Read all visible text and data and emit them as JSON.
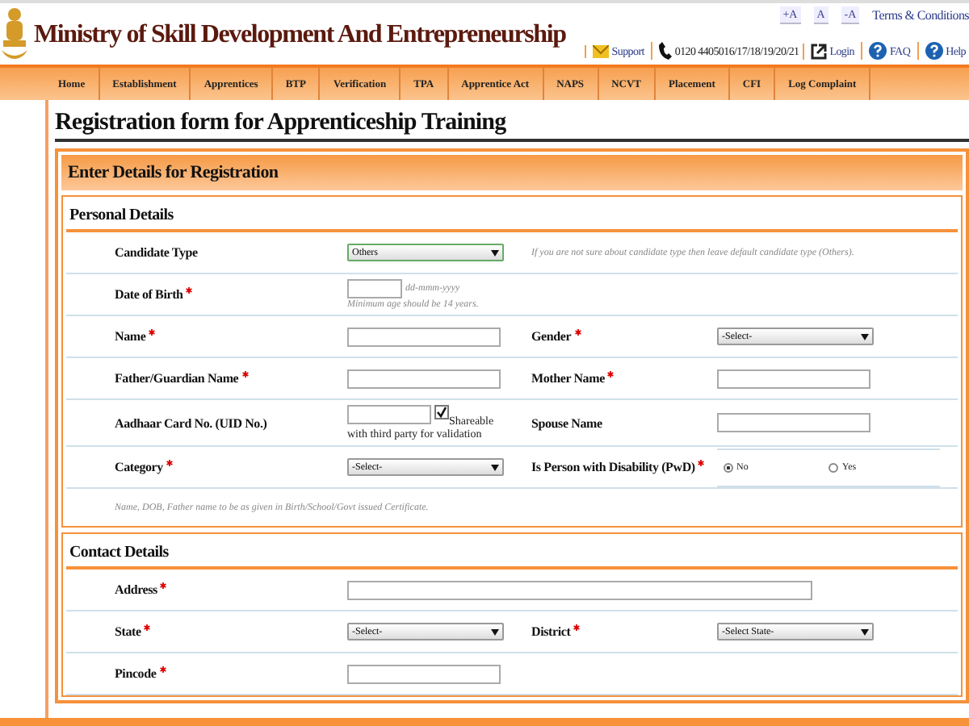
{
  "header": {
    "title": "Ministry of Skill Development And Entrepreneurship",
    "font_buttons": [
      "+A",
      "A",
      "-A"
    ],
    "terms_link": "Terms & Conditions",
    "utility_links": [
      {
        "kind": "support",
        "label": "Support"
      },
      {
        "kind": "phone",
        "label": "0120 4405016/17/18/19/20/21"
      },
      {
        "kind": "login",
        "label": "Login"
      },
      {
        "kind": "faq",
        "label": "FAQ"
      },
      {
        "kind": "help",
        "label": "Help"
      }
    ]
  },
  "nav": {
    "items": [
      "Home",
      "Establishment",
      "Apprentices",
      "BTP",
      "Verification",
      "TPA",
      "Apprentice Act",
      "NAPS",
      "NCVT",
      "Placement",
      "CFI",
      "Log Complaint"
    ]
  },
  "page_title": "Registration form for Apprenticeship Training",
  "form": {
    "header": "Enter Details for Registration",
    "sections": [
      {
        "title": "Personal Details",
        "rows": [
          {
            "fields": [
              {
                "label": "Candidate Type",
                "required": false,
                "kind": "select",
                "value": "Others",
                "hint": "If you are not sure about candidate type then leave default candidate type (Others)."
              }
            ]
          },
          {
            "fields": [
              {
                "label": "Date of Birth",
                "required": true,
                "kind": "date",
                "format_hint": "dd-mmm-yyyy",
                "hint": "Minimum age should be 14 years."
              }
            ]
          },
          {
            "fields": [
              {
                "label": "Name",
                "required": true,
                "kind": "text"
              },
              {
                "label": "Gender",
                "required": true,
                "kind": "select",
                "value": "-Select-"
              }
            ]
          },
          {
            "fields": [
              {
                "label": "Father/Guardian Name",
                "required": true,
                "kind": "text"
              },
              {
                "label": "Mother Name",
                "required": true,
                "kind": "text"
              }
            ]
          },
          {
            "fields": [
              {
                "label": "Aadhaar Card No. (UID No.)",
                "required": false,
                "kind": "aadhaar",
                "checkbox": {
                  "label": "Shareable with third party for validation",
                  "checked": true
                }
              },
              {
                "label": "Spouse Name",
                "required": false,
                "kind": "text"
              }
            ]
          },
          {
            "fields": [
              {
                "label": "Category",
                "required": true,
                "kind": "select",
                "value": "-Select-"
              },
              {
                "label": "Is Person with Disability (PwD)",
                "required": true,
                "kind": "radio",
                "options": [
                  {
                    "label": "No",
                    "selected": true
                  },
                  {
                    "label": "Yes",
                    "selected": false
                  }
                ]
              }
            ]
          }
        ],
        "note": "Name, DOB, Father name to be as given in Birth/School/Govt issued Certificate."
      },
      {
        "title": "Contact Details",
        "rows": [
          {
            "fields": [
              {
                "label": "Address",
                "required": true,
                "kind": "wide_text"
              }
            ]
          },
          {
            "fields": [
              {
                "label": "State",
                "required": true,
                "kind": "select",
                "value": "-Select-"
              },
              {
                "label": "District",
                "required": true,
                "kind": "select",
                "value": "-Select State-"
              }
            ]
          },
          {
            "fields": [
              {
                "label": "Pincode",
                "required": true,
                "kind": "text"
              }
            ]
          }
        ]
      }
    ]
  }
}
